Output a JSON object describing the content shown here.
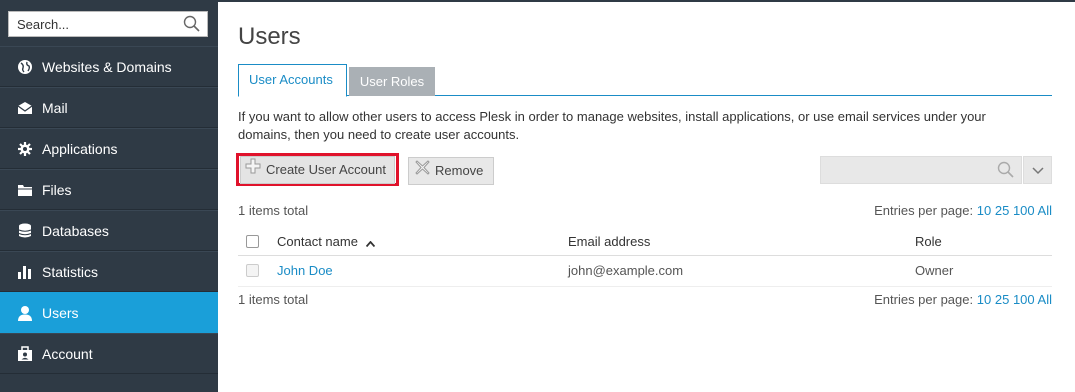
{
  "sidebar": {
    "search_placeholder": "Search...",
    "items": [
      {
        "label": "Websites & Domains",
        "icon": "globe-icon"
      },
      {
        "label": "Mail",
        "icon": "mail-icon"
      },
      {
        "label": "Applications",
        "icon": "gear-icon"
      },
      {
        "label": "Files",
        "icon": "folder-icon"
      },
      {
        "label": "Databases",
        "icon": "database-icon"
      },
      {
        "label": "Statistics",
        "icon": "bar-chart-icon"
      },
      {
        "label": "Users",
        "icon": "user-icon",
        "active": true
      },
      {
        "label": "Account",
        "icon": "account-icon"
      }
    ]
  },
  "main": {
    "title": "Users",
    "tabs": [
      {
        "label": "User Accounts",
        "active": true
      },
      {
        "label": "User Roles"
      }
    ],
    "description": "If you want to allow other users to access Plesk in order to manage websites, install applications, or use email services under your domains, then you need to create user accounts.",
    "toolbar": {
      "create_label": "Create User Account",
      "remove_label": "Remove"
    },
    "items_total": "1 items total",
    "entries_label": "Entries per page:",
    "entries_options": [
      "10",
      "25",
      "100",
      "All"
    ],
    "table": {
      "columns": [
        "Contact name",
        "Email address",
        "Role"
      ],
      "rows": [
        {
          "name": "John Doe",
          "email": "john@example.com",
          "role": "Owner"
        }
      ]
    }
  },
  "colors": {
    "sidebar_bg": "#2f3a45",
    "active_item": "#1a9fd9",
    "link": "#1a8cc6",
    "highlight": "#e0122b"
  }
}
